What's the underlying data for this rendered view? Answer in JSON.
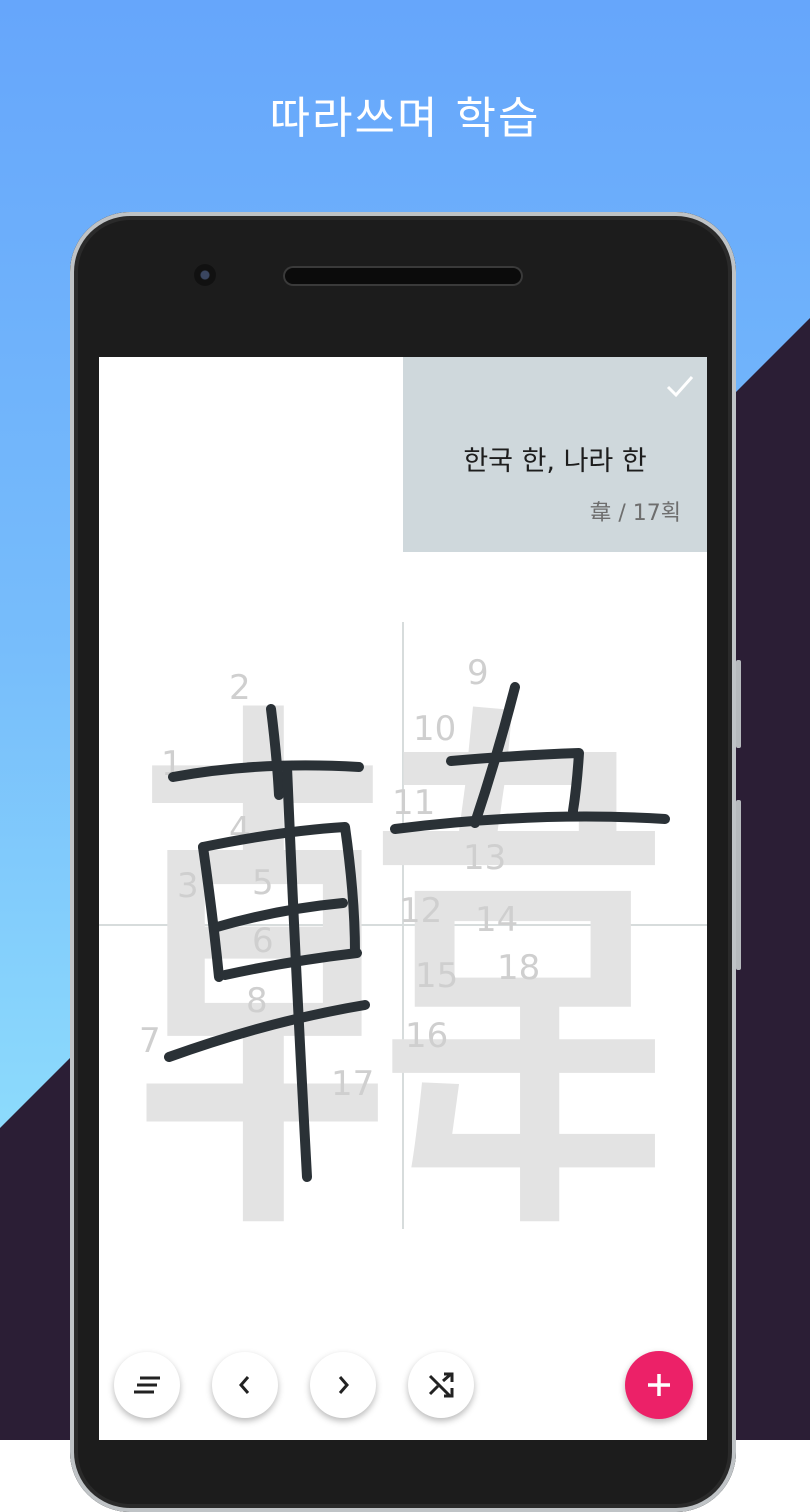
{
  "promo": {
    "title": "따라쓰며 학습"
  },
  "card": {
    "meaning": "한국 한, 나라 한",
    "radical_strokes": "韋 / 17획",
    "check_icon": "check-icon"
  },
  "guide": {
    "character": "韓",
    "stroke_numbers": [
      "1",
      "2",
      "3",
      "4",
      "5",
      "6",
      "7",
      "8",
      "9",
      "10",
      "11",
      "12",
      "13",
      "14",
      "15",
      "16",
      "17",
      "18"
    ]
  },
  "toolbar": {
    "buttons": [
      "menu-icon",
      "chevron-left-icon",
      "chevron-right-icon",
      "shuffle-icon",
      "plus-icon"
    ]
  },
  "colors": {
    "accent": "#ec2168",
    "card_bg": "#cfd8dc",
    "ink": "#2a3136",
    "guide": "#dcdcdc",
    "bg_top": "#66a6fb",
    "bg_dark": "#2b1e35"
  }
}
